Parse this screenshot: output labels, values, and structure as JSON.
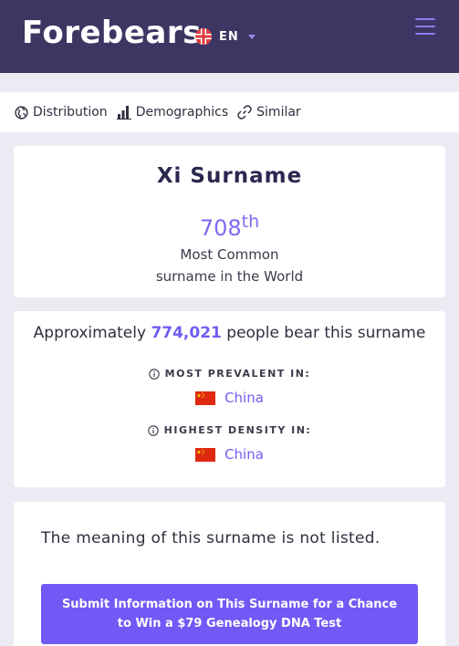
{
  "header": {
    "logo": "Forebears",
    "language": "EN",
    "icons": {
      "flag": "uk-flag-icon",
      "menu": "hamburger-menu-icon",
      "caret": "chevron-down-icon"
    }
  },
  "subnav": {
    "items": [
      {
        "label": "Distribution",
        "icon": "globe-icon"
      },
      {
        "label": "Demographics",
        "icon": "bar-chart-icon"
      },
      {
        "label": "Similar",
        "icon": "link-icon"
      }
    ]
  },
  "summary": {
    "title": "Xi Surname",
    "rank_number": "708",
    "rank_suffix": "th",
    "rank_line1": "Most Common",
    "rank_line2": "surname in the World"
  },
  "population": {
    "prefix": "Approximately",
    "count": "774,021",
    "suffix": "people bear this surname",
    "most_prevalent_label": "MOST PREVALENT IN:",
    "most_prevalent_country": "China",
    "highest_density_label": "HIGHEST DENSITY IN:",
    "highest_density_country": "China"
  },
  "meaning": {
    "text": "The meaning of this surname is not listed.",
    "button_line1": "Submit Information on This Surname for a Chance",
    "button_line2": "to Win a $79 Genealogy DNA Test"
  },
  "colors": {
    "header_bg": "#3f3562",
    "accent": "#7159f5",
    "link": "#6e5ef0",
    "page_bg": "#ebebf3"
  }
}
